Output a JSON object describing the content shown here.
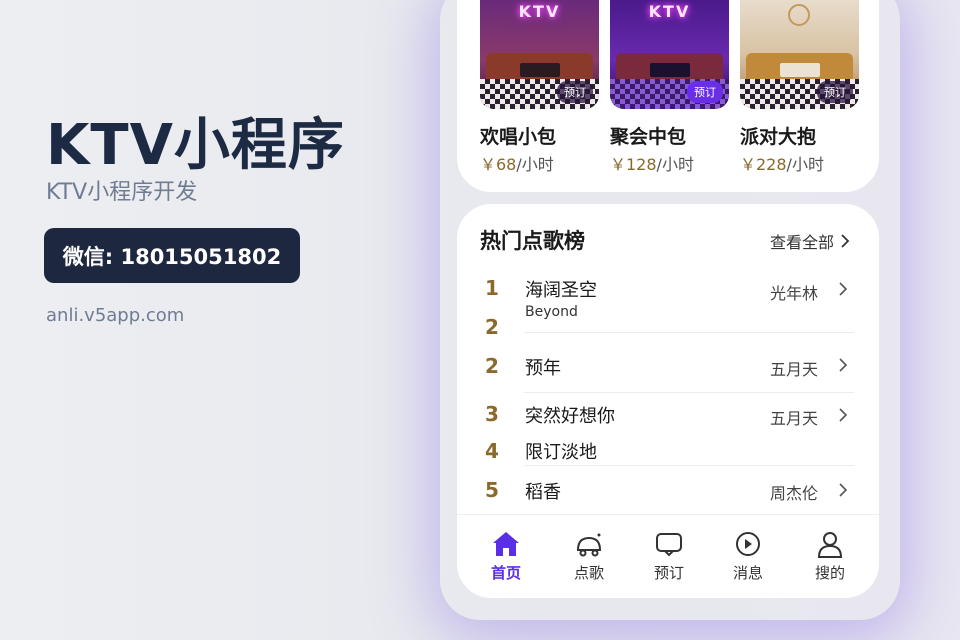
{
  "promo": {
    "title": "KTV小程序",
    "subtitle": "KTV小程序开发",
    "wechat": "微信: 18015051802",
    "site": "anli.v5app.com"
  },
  "rooms": [
    {
      "sign": "KTV",
      "tag": "预订",
      "name": "欢唱小包",
      "price": "￥68",
      "unit": "/小时"
    },
    {
      "sign": "KTV",
      "tag": "预订",
      "name": "聚会中包",
      "price": "￥128",
      "unit": "/小时"
    },
    {
      "sign": "",
      "tag": "预订",
      "name": "派对大抱",
      "price": "￥228",
      "unit": "/小时"
    }
  ],
  "hot_list": {
    "title": "热门点歌榜",
    "view_all": "查看全部",
    "songs": [
      {
        "rank": "1",
        "name": "海阔圣空",
        "sub": "Beyond",
        "artist": "光年林"
      },
      {
        "rank": "2",
        "name": "",
        "sub": "",
        "artist": ""
      },
      {
        "rank": "2",
        "name": "预年",
        "sub": "",
        "artist": "五月天"
      },
      {
        "rank": "3",
        "name": "突然好想你",
        "sub": "",
        "artist": "五月天"
      },
      {
        "rank": "4",
        "name": "限订淡地",
        "sub": "",
        "artist": ""
      },
      {
        "rank": "5",
        "name": "稻香",
        "sub": "",
        "artist": "周杰伦"
      }
    ]
  },
  "tabs": [
    {
      "label": "首页",
      "icon": "home-icon",
      "active": true
    },
    {
      "label": "点歌",
      "icon": "song-icon",
      "active": false
    },
    {
      "label": "预订",
      "icon": "booking-icon",
      "active": false
    },
    {
      "label": "消息",
      "icon": "message-icon",
      "active": false
    },
    {
      "label": "搜的",
      "icon": "profile-icon",
      "active": false
    }
  ],
  "colors": {
    "accent": "#5a2ee6",
    "price": "#8a6a2c",
    "dark_box": "#1e2740"
  }
}
